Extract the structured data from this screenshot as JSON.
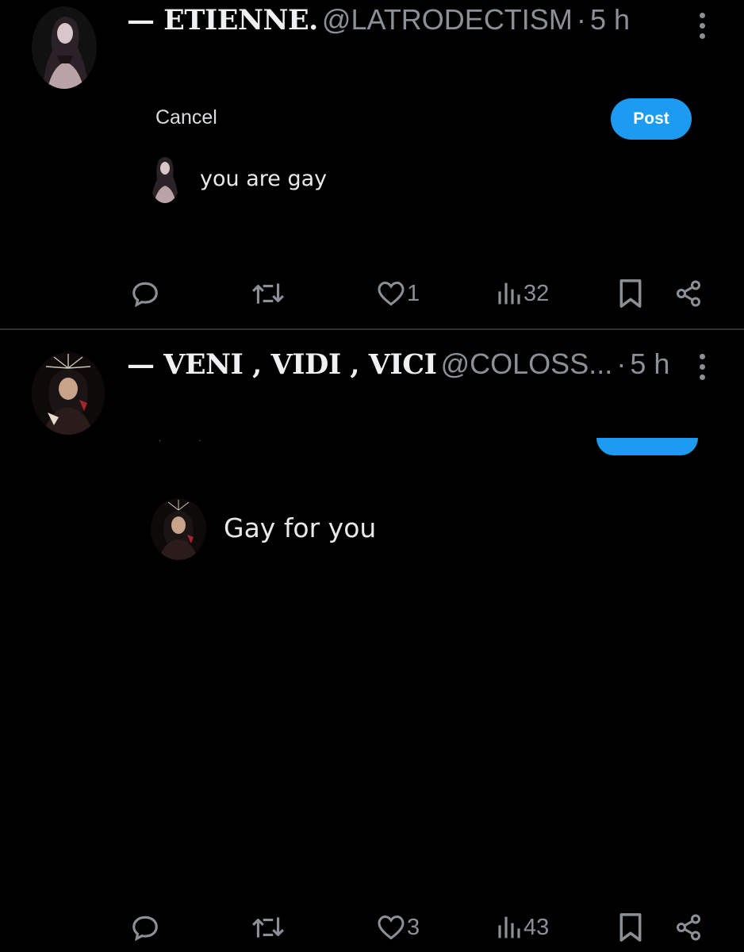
{
  "posts": [
    {
      "display_name": "— ETIENNE.",
      "handle": "@LATRODECTISM",
      "separator": "·",
      "time": "5 h",
      "composer": {
        "cancel_label": "Cancel",
        "post_label": "Post"
      },
      "reply_text": "you are gay",
      "stats": {
        "likes": "1",
        "views": "32"
      }
    },
    {
      "display_name": "— VENI , VIDI , VICI",
      "handle": "@COLOSS...",
      "separator": "·",
      "time": "5 h",
      "reply_text": "Gay for you",
      "stats": {
        "likes": "3",
        "views": "43"
      }
    }
  ],
  "colors": {
    "accent": "#1d9bf0",
    "muted": "#8b9096",
    "text": "#e7e9ea",
    "background": "#000000"
  },
  "icons": [
    "reply-icon",
    "repost-icon",
    "like-icon",
    "views-icon",
    "bookmark-icon",
    "share-icon",
    "more-icon"
  ]
}
